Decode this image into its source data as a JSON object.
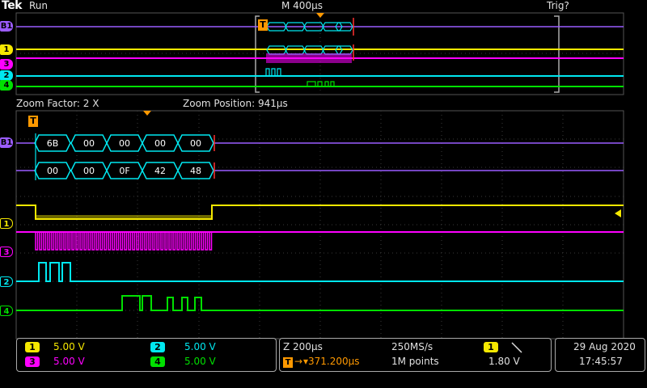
{
  "header": {
    "brand": "Tek",
    "run_state": "Run",
    "timebase": "M 400µs",
    "trigger_state": "Trig?"
  },
  "zoom": {
    "factor_label": "Zoom Factor: 2 X",
    "position_label": "Zoom Position: 941µs"
  },
  "markers": {
    "trigger": "T",
    "bus1": "B1",
    "ch1": "1",
    "ch2": "2",
    "ch3": "3",
    "ch4": "4"
  },
  "bus_data": {
    "row1": [
      "6B",
      "00",
      "00",
      "00",
      "00"
    ],
    "row2": [
      "00",
      "00",
      "0F",
      "42",
      "48"
    ]
  },
  "colors": {
    "ch1": "#f5e800",
    "ch2": "#00e8f0",
    "ch3": "#ff00ff",
    "ch4": "#00e000",
    "bus": "#9b5cff",
    "trigger": "#ff9900"
  },
  "channels": [
    {
      "num": "1",
      "scale": "5.00 V",
      "color": "#f5e800"
    },
    {
      "num": "2",
      "scale": "5.00 V",
      "color": "#00e8f0"
    },
    {
      "num": "3",
      "scale": "5.00 V",
      "color": "#ff00ff"
    },
    {
      "num": "4",
      "scale": "5.00 V",
      "color": "#00e000"
    }
  ],
  "acquisition": {
    "zoom_time": "Z 200µs",
    "trigger_pos": "▾371.200µs",
    "sample_rate": "250MS/s",
    "record_length": "1M points"
  },
  "trigger_panel": {
    "source": "1",
    "slope_icon": "falling-edge-icon",
    "level": "1.80 V"
  },
  "datetime": {
    "date": "29 Aug 2020",
    "time": "17:45:57"
  }
}
